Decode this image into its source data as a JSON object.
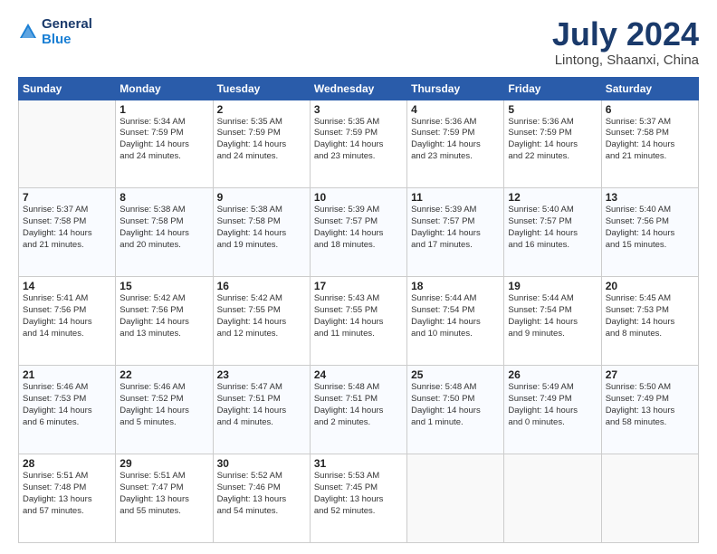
{
  "header": {
    "logo_line1": "General",
    "logo_line2": "Blue",
    "title": "July 2024",
    "subtitle": "Lintong, Shaanxi, China"
  },
  "columns": [
    "Sunday",
    "Monday",
    "Tuesday",
    "Wednesday",
    "Thursday",
    "Friday",
    "Saturday"
  ],
  "weeks": [
    [
      {
        "day": "",
        "info": ""
      },
      {
        "day": "1",
        "info": "Sunrise: 5:34 AM\nSunset: 7:59 PM\nDaylight: 14 hours\nand 24 minutes."
      },
      {
        "day": "2",
        "info": "Sunrise: 5:35 AM\nSunset: 7:59 PM\nDaylight: 14 hours\nand 24 minutes."
      },
      {
        "day": "3",
        "info": "Sunrise: 5:35 AM\nSunset: 7:59 PM\nDaylight: 14 hours\nand 23 minutes."
      },
      {
        "day": "4",
        "info": "Sunrise: 5:36 AM\nSunset: 7:59 PM\nDaylight: 14 hours\nand 23 minutes."
      },
      {
        "day": "5",
        "info": "Sunrise: 5:36 AM\nSunset: 7:59 PM\nDaylight: 14 hours\nand 22 minutes."
      },
      {
        "day": "6",
        "info": "Sunrise: 5:37 AM\nSunset: 7:58 PM\nDaylight: 14 hours\nand 21 minutes."
      }
    ],
    [
      {
        "day": "7",
        "info": "Sunrise: 5:37 AM\nSunset: 7:58 PM\nDaylight: 14 hours\nand 21 minutes."
      },
      {
        "day": "8",
        "info": "Sunrise: 5:38 AM\nSunset: 7:58 PM\nDaylight: 14 hours\nand 20 minutes."
      },
      {
        "day": "9",
        "info": "Sunrise: 5:38 AM\nSunset: 7:58 PM\nDaylight: 14 hours\nand 19 minutes."
      },
      {
        "day": "10",
        "info": "Sunrise: 5:39 AM\nSunset: 7:57 PM\nDaylight: 14 hours\nand 18 minutes."
      },
      {
        "day": "11",
        "info": "Sunrise: 5:39 AM\nSunset: 7:57 PM\nDaylight: 14 hours\nand 17 minutes."
      },
      {
        "day": "12",
        "info": "Sunrise: 5:40 AM\nSunset: 7:57 PM\nDaylight: 14 hours\nand 16 minutes."
      },
      {
        "day": "13",
        "info": "Sunrise: 5:40 AM\nSunset: 7:56 PM\nDaylight: 14 hours\nand 15 minutes."
      }
    ],
    [
      {
        "day": "14",
        "info": "Sunrise: 5:41 AM\nSunset: 7:56 PM\nDaylight: 14 hours\nand 14 minutes."
      },
      {
        "day": "15",
        "info": "Sunrise: 5:42 AM\nSunset: 7:56 PM\nDaylight: 14 hours\nand 13 minutes."
      },
      {
        "day": "16",
        "info": "Sunrise: 5:42 AM\nSunset: 7:55 PM\nDaylight: 14 hours\nand 12 minutes."
      },
      {
        "day": "17",
        "info": "Sunrise: 5:43 AM\nSunset: 7:55 PM\nDaylight: 14 hours\nand 11 minutes."
      },
      {
        "day": "18",
        "info": "Sunrise: 5:44 AM\nSunset: 7:54 PM\nDaylight: 14 hours\nand 10 minutes."
      },
      {
        "day": "19",
        "info": "Sunrise: 5:44 AM\nSunset: 7:54 PM\nDaylight: 14 hours\nand 9 minutes."
      },
      {
        "day": "20",
        "info": "Sunrise: 5:45 AM\nSunset: 7:53 PM\nDaylight: 14 hours\nand 8 minutes."
      }
    ],
    [
      {
        "day": "21",
        "info": "Sunrise: 5:46 AM\nSunset: 7:53 PM\nDaylight: 14 hours\nand 6 minutes."
      },
      {
        "day": "22",
        "info": "Sunrise: 5:46 AM\nSunset: 7:52 PM\nDaylight: 14 hours\nand 5 minutes."
      },
      {
        "day": "23",
        "info": "Sunrise: 5:47 AM\nSunset: 7:51 PM\nDaylight: 14 hours\nand 4 minutes."
      },
      {
        "day": "24",
        "info": "Sunrise: 5:48 AM\nSunset: 7:51 PM\nDaylight: 14 hours\nand 2 minutes."
      },
      {
        "day": "25",
        "info": "Sunrise: 5:48 AM\nSunset: 7:50 PM\nDaylight: 14 hours\nand 1 minute."
      },
      {
        "day": "26",
        "info": "Sunrise: 5:49 AM\nSunset: 7:49 PM\nDaylight: 14 hours\nand 0 minutes."
      },
      {
        "day": "27",
        "info": "Sunrise: 5:50 AM\nSunset: 7:49 PM\nDaylight: 13 hours\nand 58 minutes."
      }
    ],
    [
      {
        "day": "28",
        "info": "Sunrise: 5:51 AM\nSunset: 7:48 PM\nDaylight: 13 hours\nand 57 minutes."
      },
      {
        "day": "29",
        "info": "Sunrise: 5:51 AM\nSunset: 7:47 PM\nDaylight: 13 hours\nand 55 minutes."
      },
      {
        "day": "30",
        "info": "Sunrise: 5:52 AM\nSunset: 7:46 PM\nDaylight: 13 hours\nand 54 minutes."
      },
      {
        "day": "31",
        "info": "Sunrise: 5:53 AM\nSunset: 7:45 PM\nDaylight: 13 hours\nand 52 minutes."
      },
      {
        "day": "",
        "info": ""
      },
      {
        "day": "",
        "info": ""
      },
      {
        "day": "",
        "info": ""
      }
    ]
  ]
}
